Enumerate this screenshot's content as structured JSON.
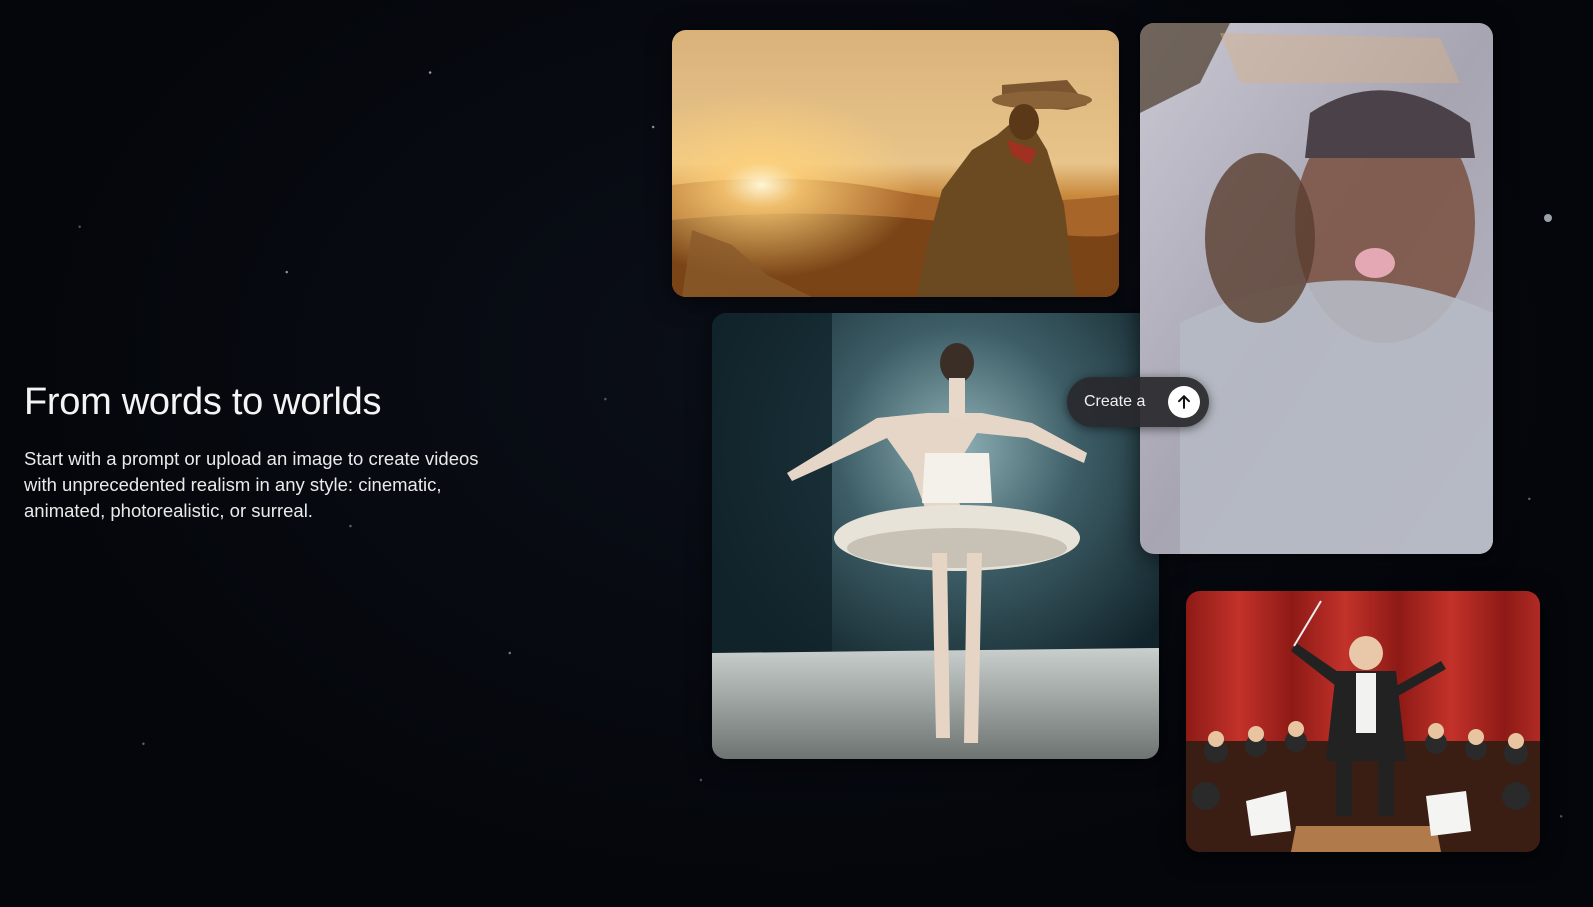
{
  "hero": {
    "title": "From words to worlds",
    "description": "Start with a prompt or upload an image to create videos with unprecedented realism in any style: cinematic, animated, photorealistic, or surreal."
  },
  "prompt": {
    "text": "Create a",
    "submit_icon": "arrow-up-icon"
  },
  "tiles": [
    {
      "subject": "cowboy-at-sunset"
    },
    {
      "subject": "ballerina-on-stage"
    },
    {
      "subject": "selfie-through-glass"
    },
    {
      "subject": "clay-orchestra-conductor"
    }
  ],
  "colors": {
    "background": "#05070c",
    "text": "#f4f4f4",
    "pill_bg": "#28282c",
    "button_bg": "#ffffff"
  }
}
